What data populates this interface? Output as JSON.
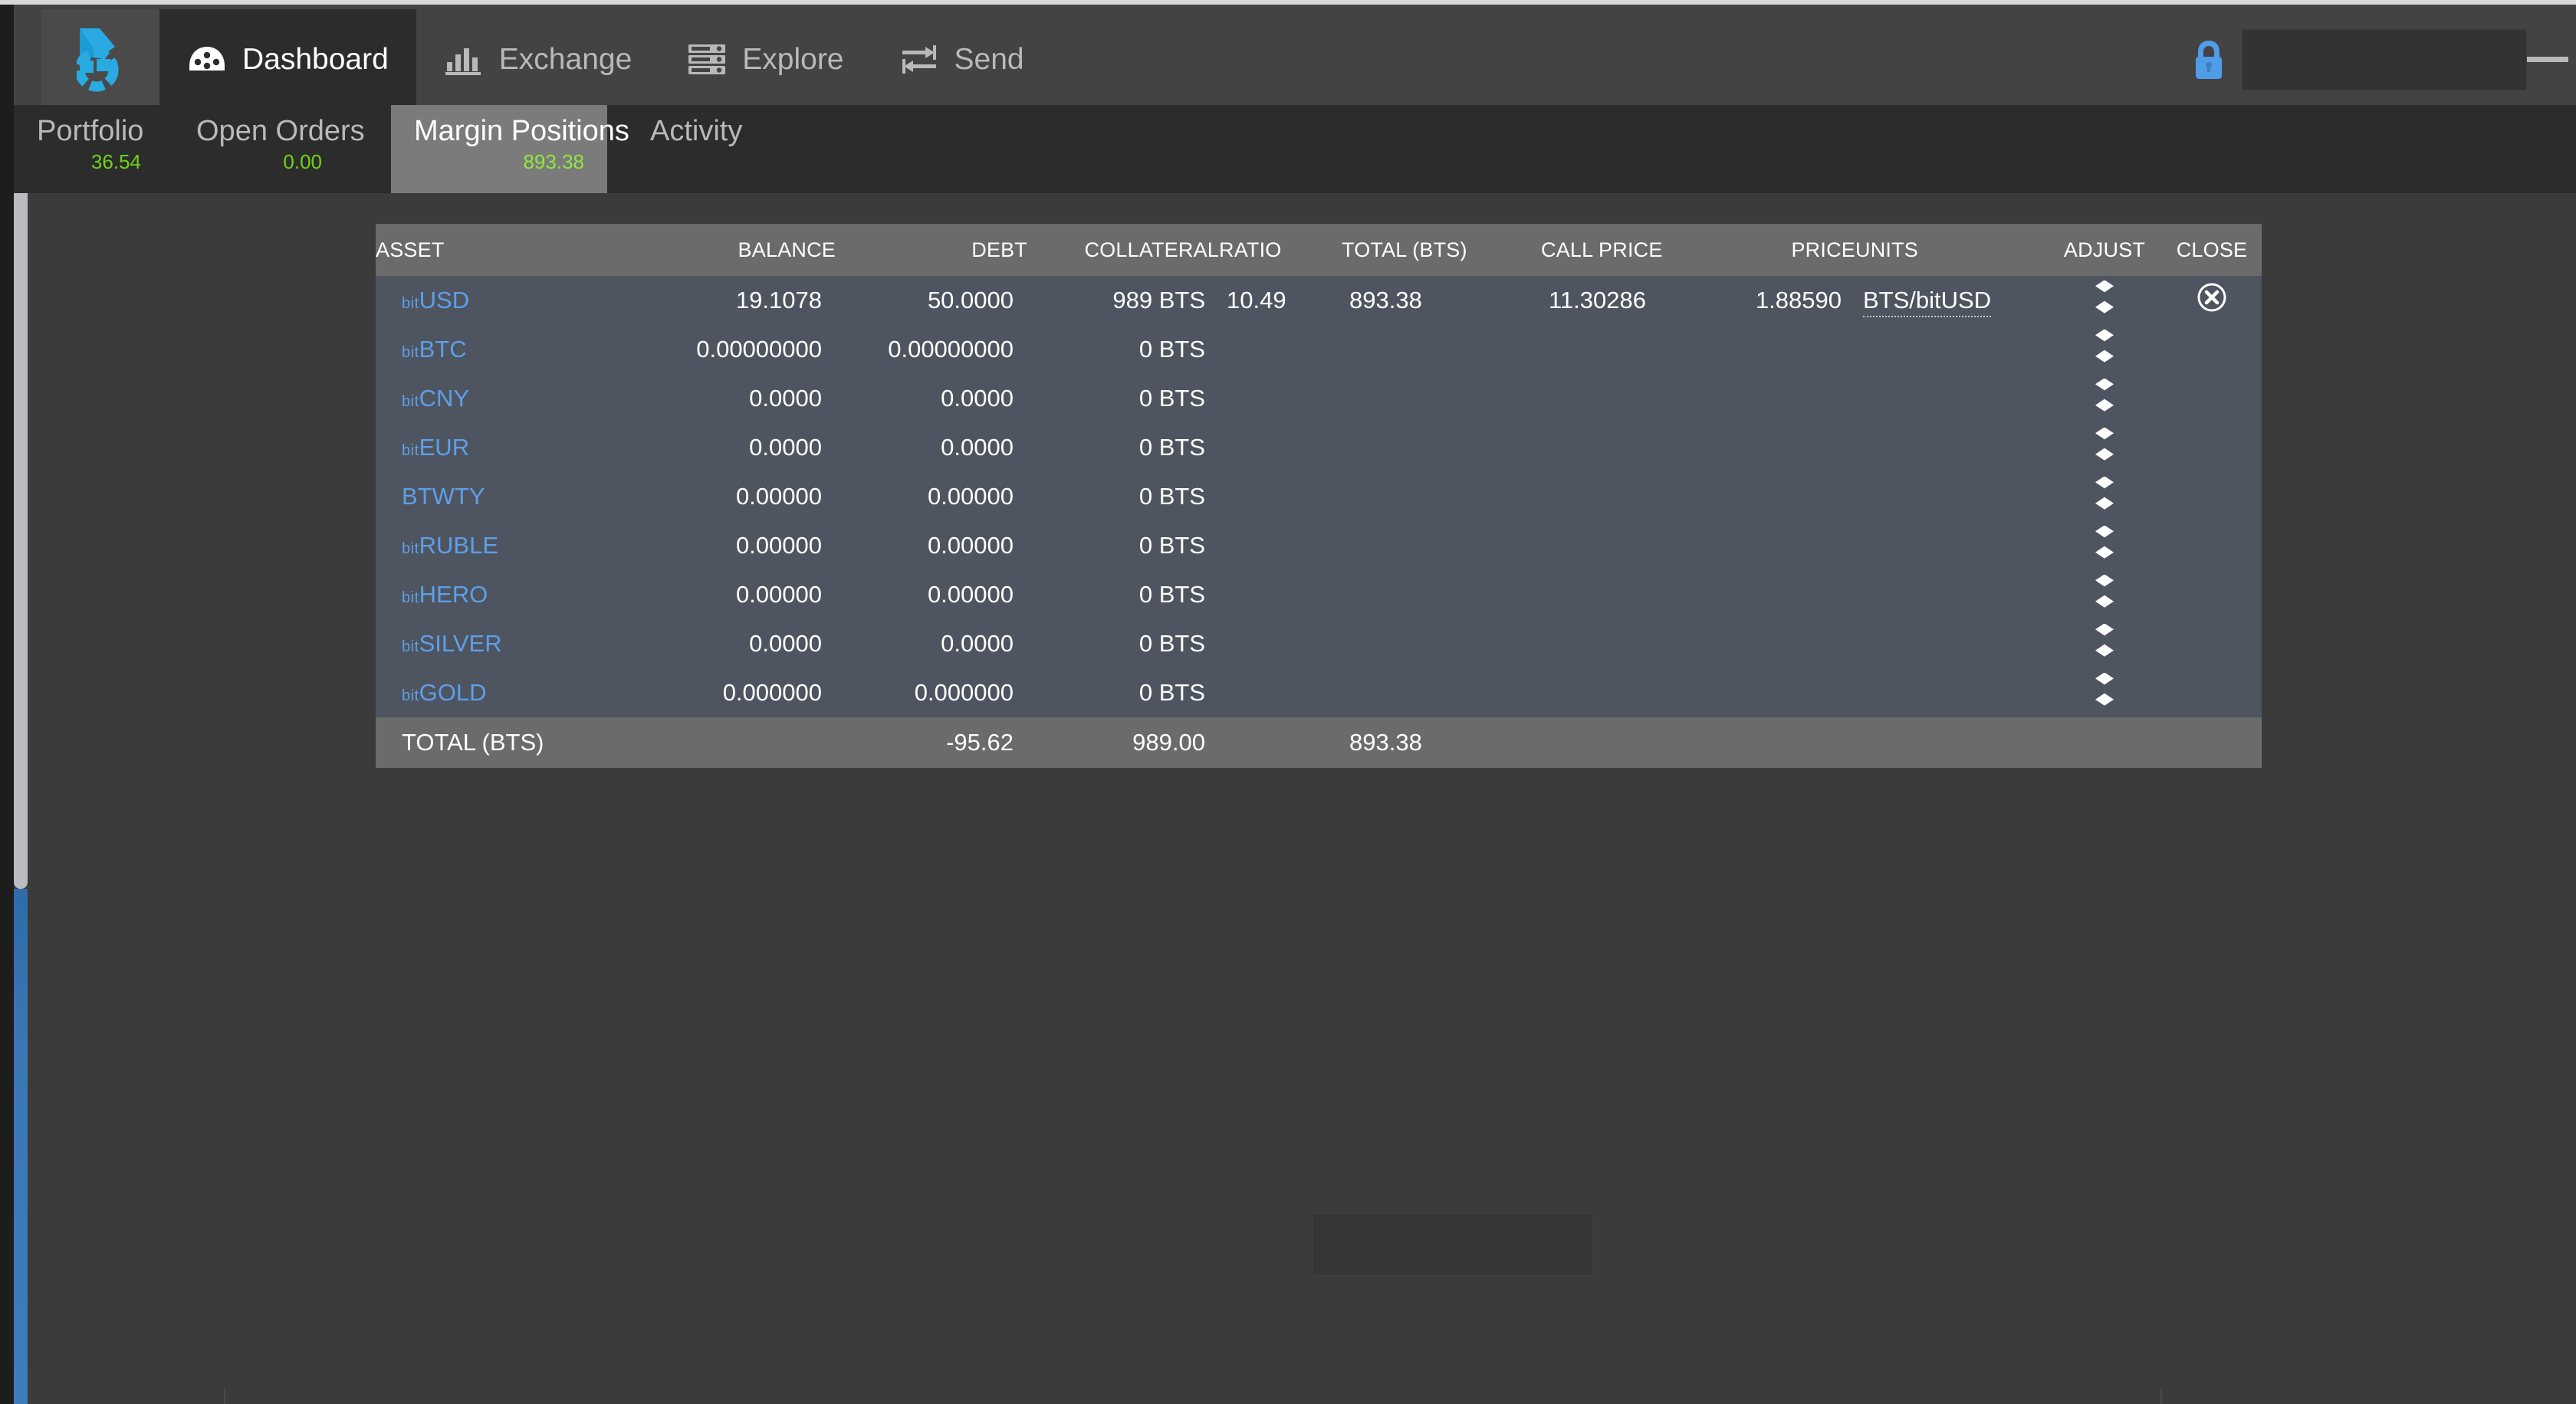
{
  "nav": {
    "logo_name": "bitshares-logo",
    "items": [
      {
        "label": "Dashboard",
        "icon": "dashboard-gauge-icon",
        "active": true
      },
      {
        "label": "Exchange",
        "icon": "bar-chart-icon",
        "active": false
      },
      {
        "label": "Explore",
        "icon": "server-list-icon",
        "active": false
      },
      {
        "label": "Send",
        "icon": "transfer-arrows-icon",
        "active": false
      }
    ],
    "lock_icon": "lock-icon",
    "search_value": "",
    "search_placeholder": "",
    "menu_icon": "hamburger-menu-icon"
  },
  "subnav": {
    "tabs": [
      {
        "label": "Portfolio",
        "value": "36.54",
        "active": false
      },
      {
        "label": "Open Orders",
        "value": "0.00",
        "active": false
      },
      {
        "label": "Margin Positions",
        "value": "893.38",
        "active": true
      },
      {
        "label": "Activity",
        "value": "",
        "active": false
      }
    ]
  },
  "table": {
    "columns": [
      "ASSET",
      "BALANCE",
      "DEBT",
      "COLLATERAL",
      "RATIO",
      "TOTAL (BTS)",
      "CALL PRICE",
      "PRICE",
      "UNITS",
      "ADJUST",
      "CLOSE"
    ],
    "rows": [
      {
        "asset_prefix": "bit",
        "asset_name": "USD",
        "balance": "19.1078",
        "debt": "50.0000",
        "collateral": "989 BTS",
        "ratio": "10.49",
        "total_bts": "893.38",
        "call_price": "11.30286",
        "price": "1.88590",
        "units": "BTS/bitUSD",
        "units_prefix": "BTS/",
        "units_pfx_small": "bit",
        "units_suffix": "USD",
        "adjust_icon": "sort-updown-icon",
        "close_icon": "close-circle-icon",
        "has_close": true
      },
      {
        "asset_prefix": "bit",
        "asset_name": "BTC",
        "balance": "0.00000000",
        "debt": "0.00000000",
        "collateral": "0 BTS",
        "ratio": "",
        "total_bts": "",
        "call_price": "",
        "price": "",
        "units": "",
        "adjust_icon": "sort-updown-icon",
        "close_icon": "",
        "has_close": false
      },
      {
        "asset_prefix": "bit",
        "asset_name": "CNY",
        "balance": "0.0000",
        "debt": "0.0000",
        "collateral": "0 BTS",
        "ratio": "",
        "total_bts": "",
        "call_price": "",
        "price": "",
        "units": "",
        "adjust_icon": "sort-updown-icon",
        "close_icon": "",
        "has_close": false
      },
      {
        "asset_prefix": "bit",
        "asset_name": "EUR",
        "balance": "0.0000",
        "debt": "0.0000",
        "collateral": "0 BTS",
        "ratio": "",
        "total_bts": "",
        "call_price": "",
        "price": "",
        "units": "",
        "adjust_icon": "sort-updown-icon",
        "close_icon": "",
        "has_close": false
      },
      {
        "asset_prefix": "",
        "asset_name": "BTWTY",
        "balance": "0.00000",
        "debt": "0.00000",
        "collateral": "0 BTS",
        "ratio": "",
        "total_bts": "",
        "call_price": "",
        "price": "",
        "units": "",
        "adjust_icon": "sort-updown-icon",
        "close_icon": "",
        "has_close": false
      },
      {
        "asset_prefix": "bit",
        "asset_name": "RUBLE",
        "balance": "0.00000",
        "debt": "0.00000",
        "collateral": "0 BTS",
        "ratio": "",
        "total_bts": "",
        "call_price": "",
        "price": "",
        "units": "",
        "adjust_icon": "sort-updown-icon",
        "close_icon": "",
        "has_close": false
      },
      {
        "asset_prefix": "bit",
        "asset_name": "HERO",
        "balance": "0.00000",
        "debt": "0.00000",
        "collateral": "0 BTS",
        "ratio": "",
        "total_bts": "",
        "call_price": "",
        "price": "",
        "units": "",
        "adjust_icon": "sort-updown-icon",
        "close_icon": "",
        "has_close": false
      },
      {
        "asset_prefix": "bit",
        "asset_name": "SILVER",
        "balance": "0.0000",
        "debt": "0.0000",
        "collateral": "0 BTS",
        "ratio": "",
        "total_bts": "",
        "call_price": "",
        "price": "",
        "units": "",
        "adjust_icon": "sort-updown-icon",
        "close_icon": "",
        "has_close": false
      },
      {
        "asset_prefix": "bit",
        "asset_name": "GOLD",
        "balance": "0.000000",
        "debt": "0.000000",
        "collateral": "0 BTS",
        "ratio": "",
        "total_bts": "",
        "call_price": "",
        "price": "",
        "units": "",
        "adjust_icon": "sort-updown-icon",
        "close_icon": "",
        "has_close": false
      }
    ],
    "footer": {
      "label": "TOTAL (BTS)",
      "balance": "",
      "debt": "-95.62",
      "collateral": "989.00",
      "ratio": "",
      "total_bts": "893.38"
    }
  },
  "colors": {
    "accent_blue": "#5e9fe8",
    "logo_blue": "#29abe2",
    "green": "#6fd316",
    "row_bg": "#4e5560",
    "header_bg": "#6b6b6b",
    "nav_bg": "#434343",
    "subnav_bg": "#2c2c2c",
    "page_bg": "#3b3b3b"
  }
}
